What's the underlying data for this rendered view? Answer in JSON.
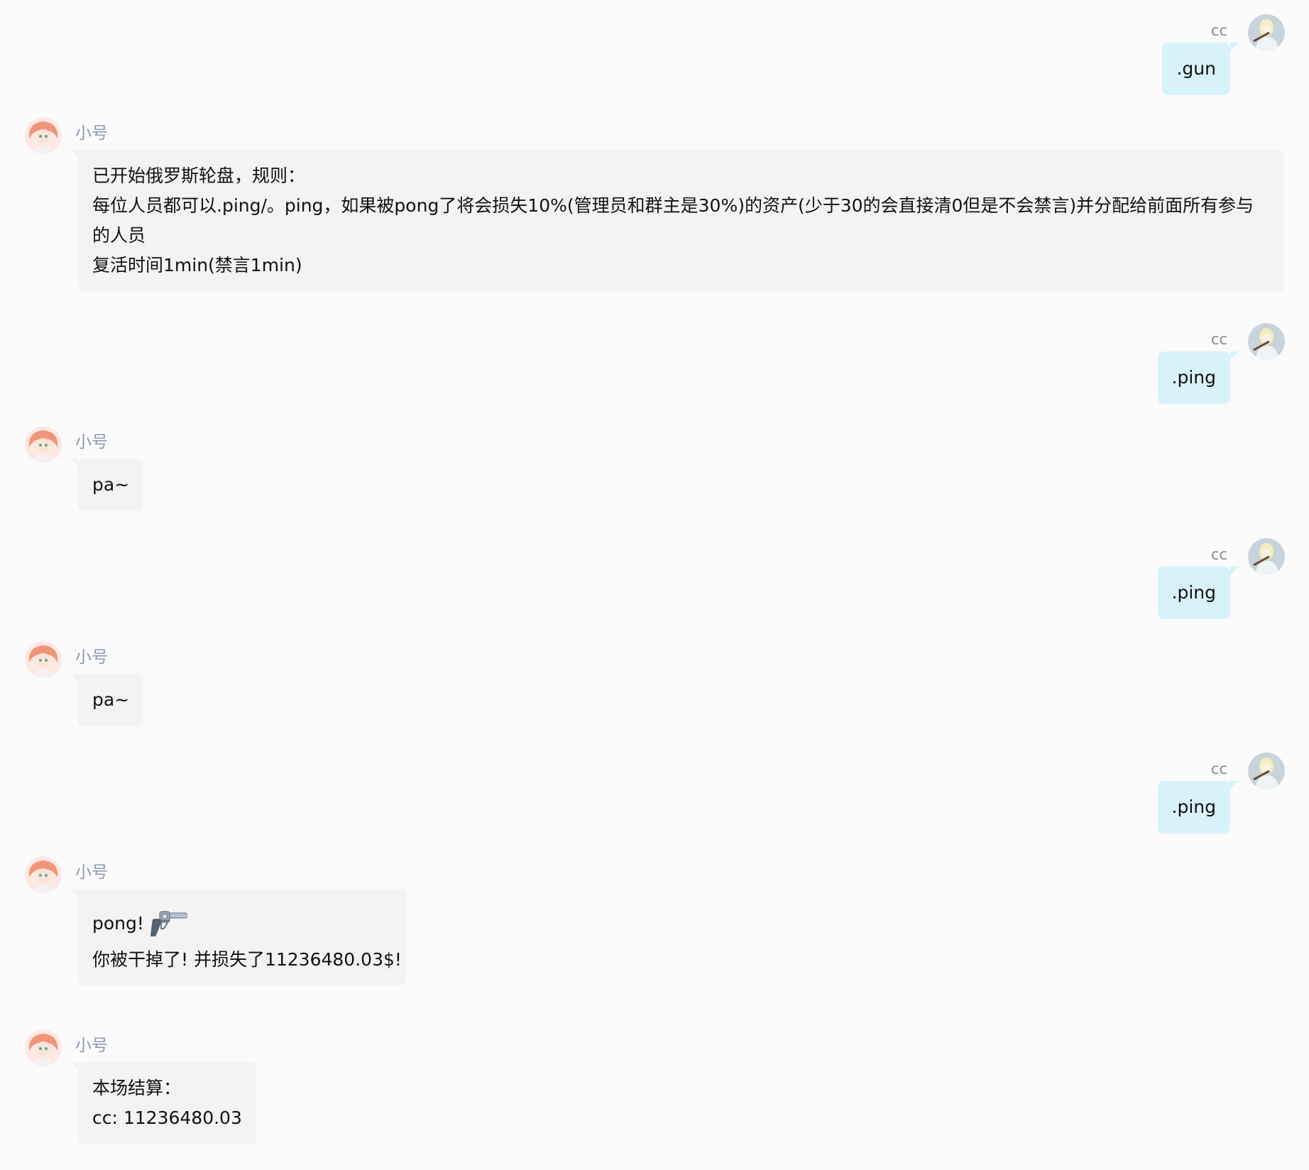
{
  "messages": [
    {
      "side": "right",
      "sender": "cc",
      "lines": [
        ".gun"
      ]
    },
    {
      "side": "left",
      "sender": "小号",
      "lines": [
        "已开始俄罗斯轮盘，规则：",
        "每位人员都可以.ping/。ping，如果被pong了将会损失10%(管理员和群主是30%)的资产(少于30的会直接清0但是不会禁言)并分配给前面所有参与的人员",
        "复活时间1min(禁言1min)"
      ]
    },
    {
      "side": "right",
      "sender": "cc",
      "lines": [
        ".ping"
      ]
    },
    {
      "side": "left",
      "sender": "小号",
      "lines": [
        "pa~"
      ]
    },
    {
      "side": "right",
      "sender": "cc",
      "lines": [
        ".ping"
      ]
    },
    {
      "side": "left",
      "sender": "小号",
      "lines": [
        "pa~"
      ]
    },
    {
      "side": "right",
      "sender": "cc",
      "lines": [
        ".ping"
      ]
    },
    {
      "side": "left",
      "sender": "小号",
      "lines": [
        "pong!",
        "你被干掉了! 并损失了11236480.03$!"
      ],
      "icon": "revolver-icon"
    },
    {
      "side": "left",
      "sender": "小号",
      "lines": [
        "本场结算：",
        "cc: 11236480.03"
      ]
    }
  ],
  "colors": {
    "background": "#fbfbfb",
    "incoming_bubble": "#f3f3f3",
    "outgoing_bubble": "#d8f2fb",
    "incoming_name": "#8d97b5",
    "outgoing_name": "#8c8c8c"
  }
}
